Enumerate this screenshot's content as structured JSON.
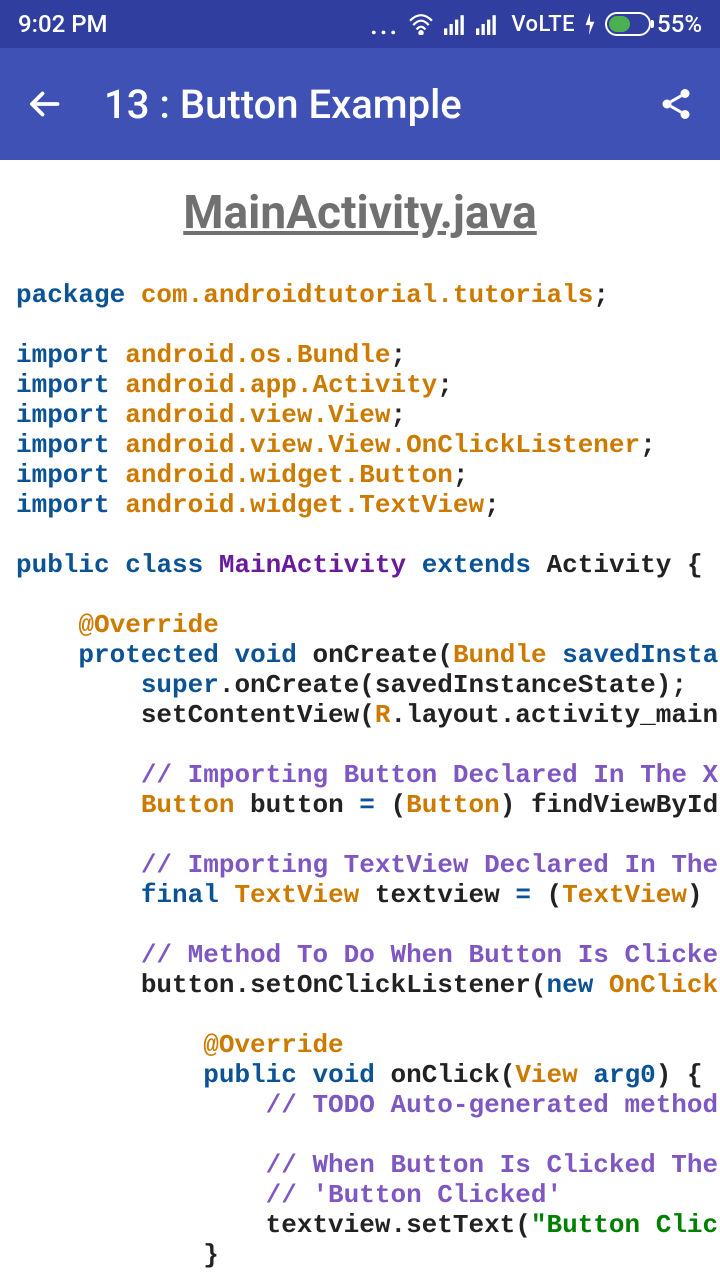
{
  "status": {
    "time": "9:02 PM",
    "volte": "VoLTE",
    "battery_pct": "55%"
  },
  "appbar": {
    "title": "13 : Button Example"
  },
  "file": {
    "title": "MainActivity.java"
  },
  "code": {
    "pkg_kw": "package",
    "pkg_name": "com.androidtutorial.tutorials",
    "import_kw": "import",
    "imports": {
      "i1": "android.os.Bundle",
      "i2": "android.app.Activity",
      "i3": "android.view.View",
      "i4": "android.view.View.OnClickListener",
      "i5": "android.widget.Button",
      "i6": "android.widget.TextView"
    },
    "public": "public",
    "class": "class",
    "main": "MainActivity",
    "extends": "extends",
    "activity": "Activity",
    "override": "@Override",
    "protected": "protected",
    "void": "void",
    "onCreate": "onCreate",
    "bundle": "Bundle",
    "savedInsta": "savedInsta",
    "super": "super",
    "onCreateCall": ".onCreate(savedInstanceState);",
    "setContent": "setContentView(",
    "R": "R",
    "dotlayout": ".layout.activity_main",
    "cmt1": "// Importing Button Declared In The X",
    "buttonType": "Button",
    "buttonDecl": " button ",
    "eq": "=",
    "cast1a": " (",
    "cast1b": ") findViewById",
    "cmt2": "// Importing TextView Declared In The",
    "final": "final",
    "textviewType": "TextView",
    "textviewDecl": " textview ",
    "cast2a": " (",
    "cast2b": ") ",
    "cmt3": "// Method To Do When Button Is Clicke",
    "setOnClick": "button.setOnClickListener(",
    "new": "new",
    "onClickType": "OnClick",
    "onClick": "onClick",
    "view": "View",
    "arg0": "arg0",
    "cmt4": "// TODO Auto-generated method",
    "cmt5": "// When Button Is Clicked The",
    "cmt6": "// 'Button Clicked'",
    "setText": "textview.setText(",
    "strlit": "\"Button Clic"
  }
}
